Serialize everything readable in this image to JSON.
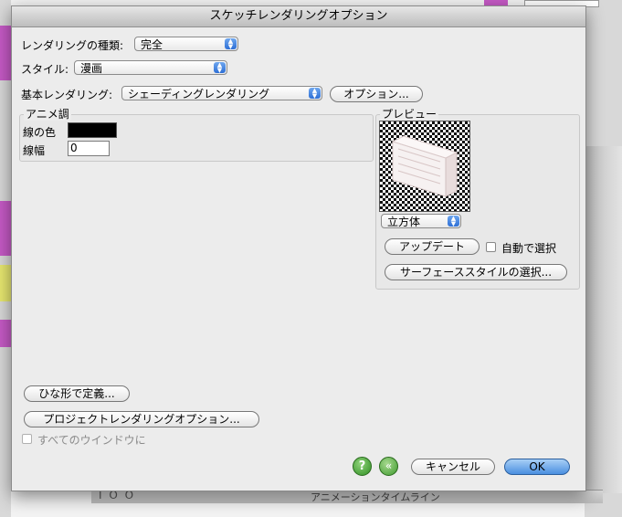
{
  "dialog": {
    "title": "スケッチレンダリングオプション",
    "rendering_type_label": "レンダリングの種類:",
    "rendering_type_value": "完全",
    "style_label": "スタイル:",
    "style_value": "漫画",
    "base_rendering_label": "基本レンダリング:",
    "base_rendering_value": "シェーディングレンダリング",
    "options_button": "オプション...",
    "anime_group": {
      "title": "アニメ調",
      "line_color_label": "線の色",
      "line_color": "#000000",
      "line_width_label": "線幅",
      "line_width_value": "0"
    },
    "preview_group": {
      "title": "プレビュー",
      "shape_value": "立方体",
      "update_button": "アップデート",
      "auto_select_label": "自動で選択",
      "surface_style_button": "サーフェーススタイルの選択..."
    },
    "define_template_button": "ひな形で定義...",
    "project_options_button": "プロジェクトレンダリングオプション...",
    "all_windows_label": "すべてのウインドウに",
    "cancel_button": "キャンセル",
    "ok_button": "OK",
    "help_icon_text": "?",
    "back_icon_text": "«"
  },
  "background": {
    "bottom_label": "アニメーションタイムライン",
    "bottom_left_text": "I O O"
  }
}
